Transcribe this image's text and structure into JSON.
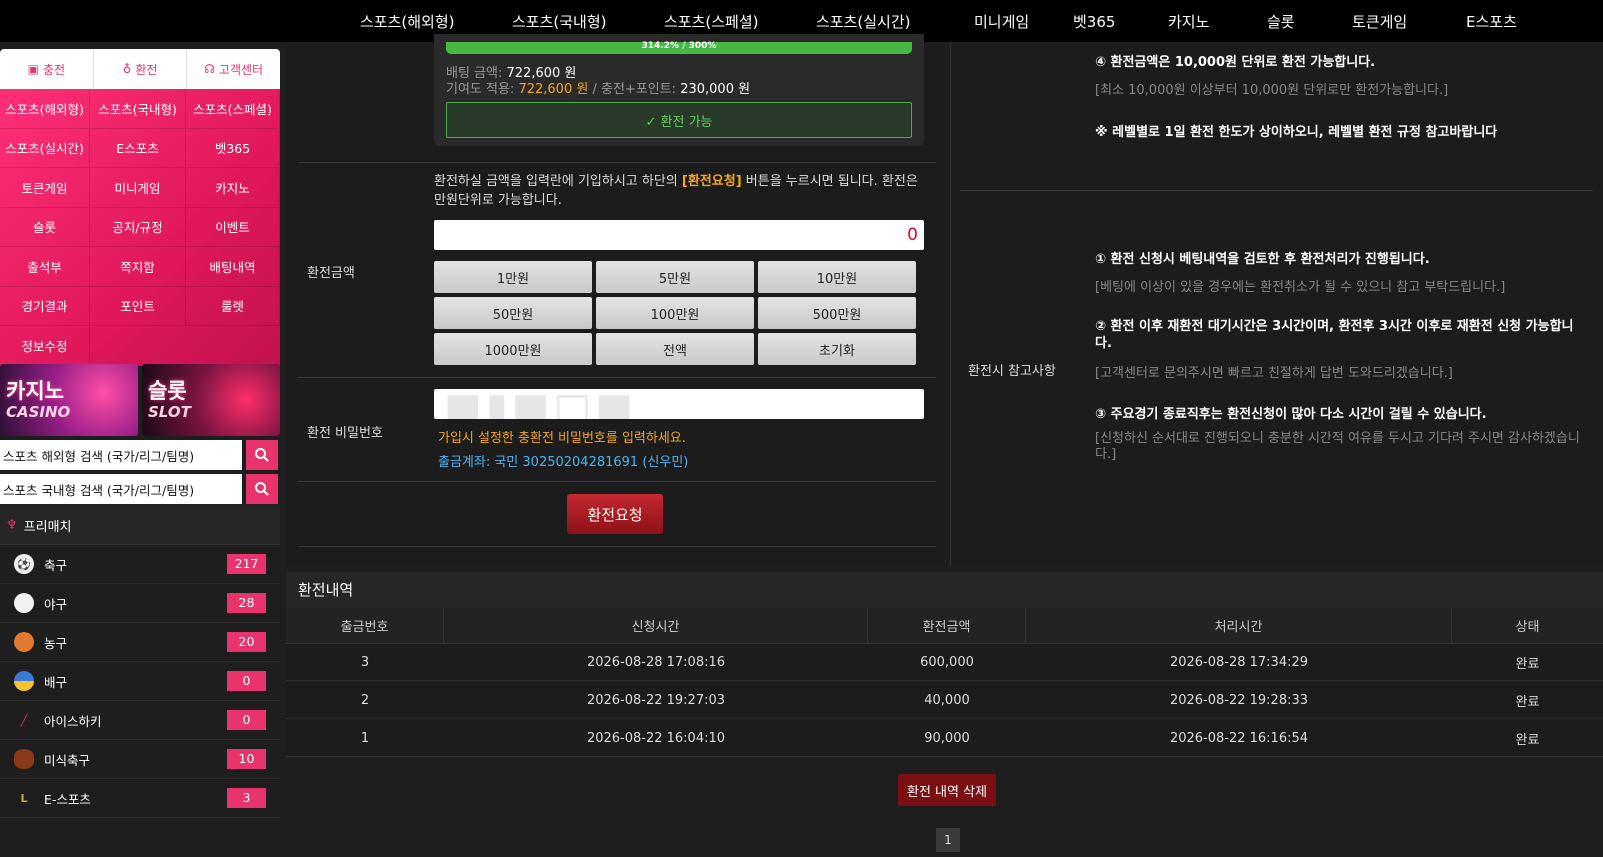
{
  "topnav": [
    "스포츠(해외형)",
    "스포츠(국내형)",
    "스포츠(스페셜)",
    "스포츠(실시간)",
    "미니게임",
    "벳365",
    "카지노",
    "슬롯",
    "토큰게임",
    "E스포츠"
  ],
  "side_tabs": [
    {
      "label": "충전",
      "icon": "wallet-icon"
    },
    {
      "label": "환전",
      "icon": "money-bag-icon"
    },
    {
      "label": "고객센터",
      "icon": "headset-icon"
    }
  ],
  "side_menu": [
    "스포츠(해외형)",
    "스포츠(국내형)",
    "스포츠(스페셜)",
    "스포츠(실시간)",
    "E스포츠",
    "벳365",
    "토큰게임",
    "미니게임",
    "카지노",
    "슬롯",
    "공지/규정",
    "이벤트",
    "출석부",
    "쪽지함",
    "배팅내역",
    "경기결과",
    "포인트",
    "룰렛",
    "정보수정"
  ],
  "banners": {
    "casino": {
      "big": "카지노",
      "small": "CASINO"
    },
    "slot": {
      "big": "슬롯",
      "small": "SLOT"
    }
  },
  "search": {
    "overseas": "스포츠 해외형 검색 (국가/리그/팀명)",
    "domestic": "스포츠 국내형 검색 (국가/리그/팀명)"
  },
  "prematch": {
    "label": "프리매치"
  },
  "sports": [
    {
      "name": "축구",
      "count": "217",
      "icon": "soccer-ball-icon"
    },
    {
      "name": "야구",
      "count": "28",
      "icon": "baseball-icon"
    },
    {
      "name": "농구",
      "count": "20",
      "icon": "basketball-icon"
    },
    {
      "name": "배구",
      "count": "0",
      "icon": "volleyball-icon"
    },
    {
      "name": "아이스하키",
      "count": "0",
      "icon": "hockey-stick-icon"
    },
    {
      "name": "미식축구",
      "count": "10",
      "icon": "american-football-icon"
    },
    {
      "name": "E-스포츠",
      "count": "3",
      "icon": "esports-icon"
    }
  ],
  "progress": {
    "text": "314.2% / 300%",
    "percent": 100
  },
  "bet_info": {
    "bet_label": "배팅 금액:",
    "bet_value": "722,600 원",
    "apply_label": "기여도 적용:",
    "apply_value": "722,600 원",
    "sep": "/",
    "charge_label": "충전+포인트:",
    "charge_value": "230,000 원"
  },
  "able_button": "✓ 환전 가능",
  "form": {
    "desc_pre": "환전하실 금액을 입력란에 기입하시고 하단의 ",
    "desc_hl": "[환전요청]",
    "desc_post": " 버튼을 누르시면 됩니다. 환전은 만원단위로 가능합니다.",
    "amount_label": "환전금액",
    "amount_value": "0",
    "amount_buttons": [
      "1만원",
      "5만원",
      "10만원",
      "50만원",
      "100만원",
      "500만원",
      "1000만원",
      "전액",
      "초기화"
    ],
    "pw_label": "환전 비밀번호",
    "pw_hint": "가입시 설정한 충환전 비밀번호를 입력하세요.",
    "account": "출금계좌: 국민 30250204281691 (신우민)",
    "submit": "환전요청"
  },
  "notes": {
    "n4": "④ 환전금액은 10,000원 단위로 환전 가능합니다.",
    "n4_sub": "[최소 10,000원 이상부터 10,000원 단위로만 환전가능합니다.]",
    "level": "※ 레벨별로 1일 환전 한도가 상이하오니, 레벨별 환전 규정 참고바랍니다",
    "right_label": "환전시 참고사항",
    "n1": "① 환전 신청시 베팅내역을 검토한 후 환전처리가 진행됩니다.",
    "n1_sub": "[베팅에 이상이 있을 경우에는 환전취소가 될 수 있으니 참고 부탁드립니다.]",
    "n2": "② 환전 이후 재환전 대기시간은 3시간이며, 환전후 3시간 이후로 재환전 신청 가능합니다.",
    "n2_sub": "[고객센터로 문의주시면 빠르고 친절하게 답변 도와드리겠습니다.]",
    "n3": "③ 주요경기 종료직후는 환전신청이 많아 다소 시간이 걸릴 수 있습니다.",
    "n3_sub": "[신청하신 순서대로 진행되오니 충분한 시간적 여유를 두시고 기다려 주시면 감사하겠습니다.]"
  },
  "history": {
    "title": "환전내역",
    "headers": [
      "출금번호",
      "신청시간",
      "환전금액",
      "처리시간",
      "상태"
    ],
    "rows": [
      [
        "3",
        "2026-08-28 17:08:16",
        "600,000",
        "2026-08-28 17:34:29",
        "완료"
      ],
      [
        "2",
        "2026-08-22 19:27:03",
        "40,000",
        "2026-08-22 19:28:33",
        "완료"
      ],
      [
        "1",
        "2026-08-22 16:04:10",
        "90,000",
        "2026-08-22 16:16:54",
        "완료"
      ]
    ],
    "delete_button": "환전 내역 삭제",
    "page": "1"
  },
  "colors": {
    "accent": "#e8336d",
    "progress": "#47b843",
    "highlight": "#f5a623",
    "link": "#4fb4f0",
    "submit": "#a01a20"
  }
}
